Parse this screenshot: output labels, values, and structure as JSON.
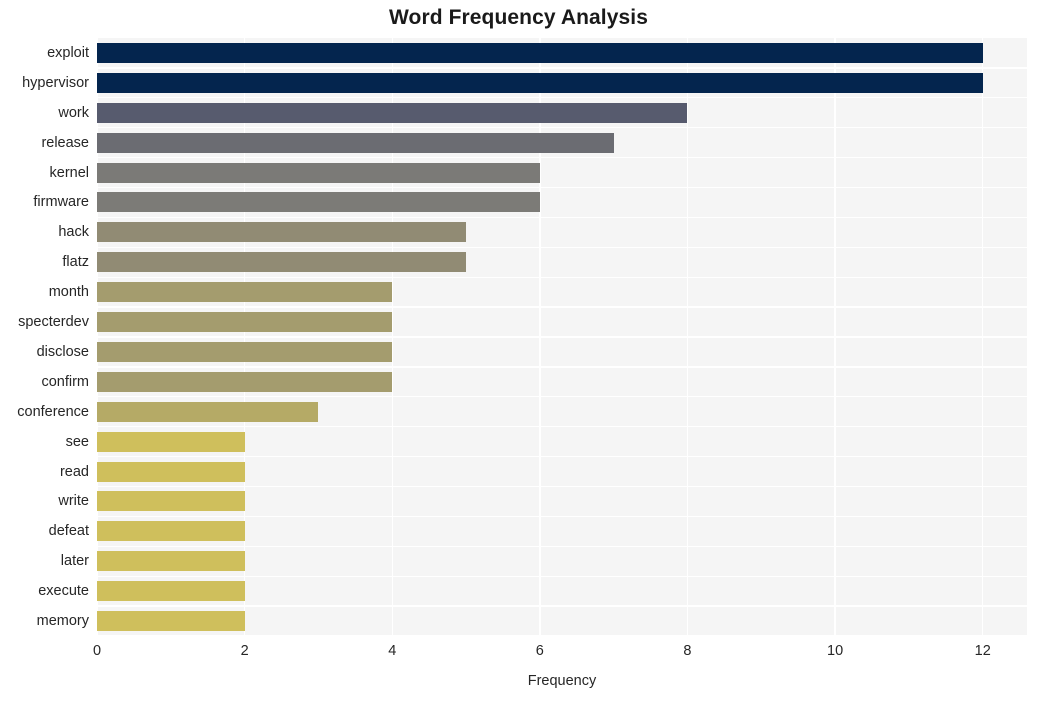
{
  "chart_data": {
    "type": "bar",
    "orientation": "horizontal",
    "title": "Word Frequency Analysis",
    "xlabel": "Frequency",
    "ylabel": "",
    "xlim": [
      0,
      12.6
    ],
    "xticks": [
      0,
      2,
      4,
      6,
      8,
      10,
      12
    ],
    "xtick_labels": [
      "0",
      "2",
      "4",
      "6",
      "8",
      "10",
      "12"
    ],
    "grid": true,
    "grid_axis": "both",
    "legend": "none",
    "categories": [
      "exploit",
      "hypervisor",
      "work",
      "release",
      "kernel",
      "firmware",
      "hack",
      "flatz",
      "month",
      "specterdev",
      "disclose",
      "confirm",
      "conference",
      "see",
      "read",
      "write",
      "defeat",
      "later",
      "execute",
      "memory"
    ],
    "values": [
      12,
      12,
      8,
      7,
      6,
      6,
      5,
      5,
      4,
      4,
      4,
      4,
      3,
      2,
      2,
      2,
      2,
      2,
      2,
      2
    ],
    "bar_colors": [
      "#04254e",
      "#04254e",
      "#575b6e",
      "#6b6c72",
      "#7b7a77",
      "#7c7b77",
      "#918b74",
      "#918b74",
      "#a49c6e",
      "#a49c6e",
      "#a49c6e",
      "#a49c6e",
      "#b5aa66",
      "#cfbf5c",
      "#cfbf5c",
      "#cfbf5c",
      "#cfbf5c",
      "#cfbf5c",
      "#cfbf5c",
      "#cfbf5c"
    ],
    "plot_background": "#f5f5f5",
    "grid_color": "#ffffff",
    "figure_background": "#ffffff",
    "text_color": "#262626"
  }
}
